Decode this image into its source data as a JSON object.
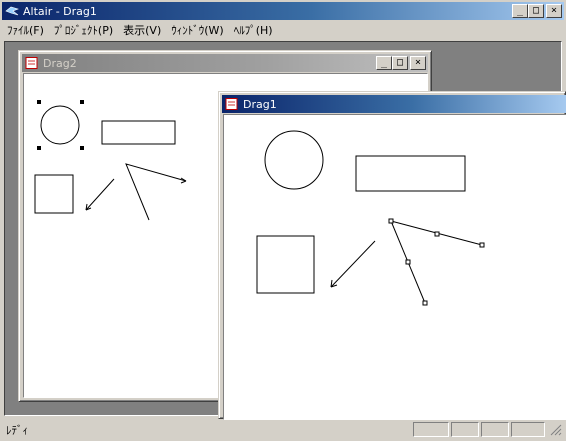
{
  "app": {
    "title": "Altair - Drag1"
  },
  "menu": {
    "items": [
      {
        "label": "ﾌｧｲﾙ(F)"
      },
      {
        "label": "ﾌﾟﾛｼﾞｪｸﾄ(P)"
      },
      {
        "label": "表示(V)"
      },
      {
        "label": "ｳｨﾝﾄﾞｳ(W)"
      },
      {
        "label": "ﾍﾙﾌﾟ(H)"
      }
    ]
  },
  "windows": {
    "drag2": {
      "title": "Drag2"
    },
    "drag1": {
      "title": "Drag1"
    }
  },
  "status": {
    "text": "ﾚﾃﾞｨ"
  },
  "colors": {
    "active_title": "#0a246a",
    "inactive_title": "#808080",
    "face": "#d4d0c8"
  }
}
